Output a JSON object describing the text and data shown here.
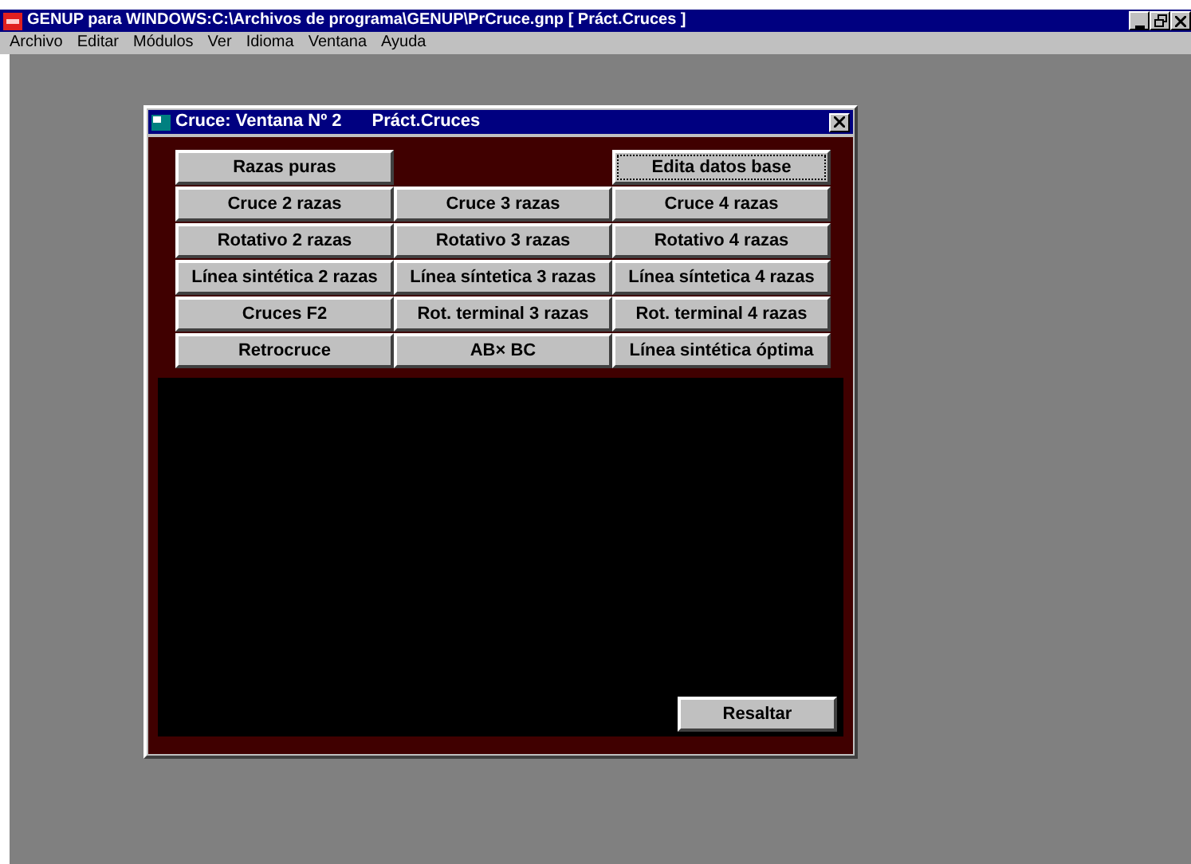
{
  "window": {
    "title": "GENUP para WINDOWS:C:\\Archivos de programa\\GENUP\\PrCruce.gnp  [ Práct.Cruces ]"
  },
  "menu_items": [
    "Archivo",
    "Editar",
    "Módulos",
    "Ver",
    "Idioma",
    "Ventana",
    "Ayuda"
  ],
  "child_window": {
    "title": "Cruce: Ventana Nº 2",
    "subtitle": "Práct.Cruces",
    "first_row": [
      {
        "label": "Razas puras",
        "focused": false
      },
      {
        "label": "Edita datos base",
        "focused": true
      }
    ],
    "buttons": [
      "Cruce 2 razas",
      "Cruce 3 razas",
      "Cruce 4 razas",
      "Rotativo 2 razas",
      "Rotativo 3 razas",
      "Rotativo 4 razas",
      "Línea sintética 2 razas",
      "Línea síntetica 3 razas",
      "Línea síntetica 4 razas",
      "Cruces F2",
      "Rot. terminal 3 razas",
      "Rot. terminal 4 razas",
      "Retrocruce",
      "AB× BC",
      "Línea sintética óptima"
    ],
    "highlight_button": "Resaltar"
  }
}
